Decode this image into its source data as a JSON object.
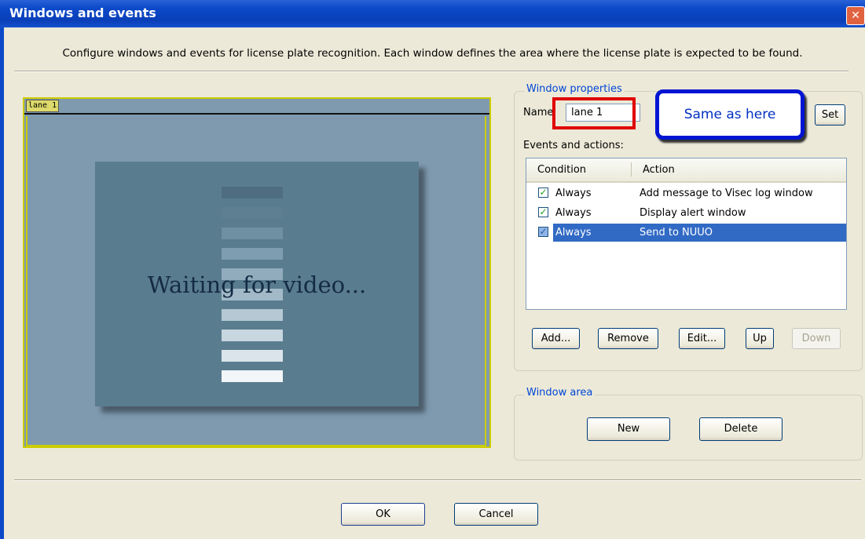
{
  "window": {
    "title": "Windows and events",
    "close_glyph": "✕",
    "description": "Configure windows and events for license plate recognition. Each window defines the area where the license plate is expected to be found."
  },
  "video": {
    "lane_label": "lane 1",
    "waiting_text": "Waiting for video..."
  },
  "window_properties": {
    "legend": "Window properties",
    "name_label": "Name",
    "name_value": "lane 1",
    "set_label": "Set",
    "events_label": "Events and actions:",
    "columns": [
      "Condition",
      "Action"
    ],
    "rows": [
      {
        "condition": "Always",
        "action": "Add message to Visec log window",
        "checked": true,
        "selected": false
      },
      {
        "condition": "Always",
        "action": "Display alert window",
        "checked": true,
        "selected": false
      },
      {
        "condition": "Always",
        "action": "Send to NUUO",
        "checked": true,
        "selected": true
      }
    ],
    "buttons": {
      "add": "Add...",
      "remove": "Remove",
      "edit": "Edit...",
      "up": "Up",
      "down": "Down"
    }
  },
  "annotation": {
    "callout_text": "Same as here"
  },
  "window_area": {
    "legend": "Window area",
    "new_label": "New",
    "delete_label": "Delete"
  },
  "footer": {
    "ok_label": "OK",
    "cancel_label": "Cancel"
  },
  "colors": {
    "title_bar": "#0b49c9",
    "selection": "#316ac5",
    "highlight_box": "#e00000",
    "callout_border": "#0014d4"
  }
}
